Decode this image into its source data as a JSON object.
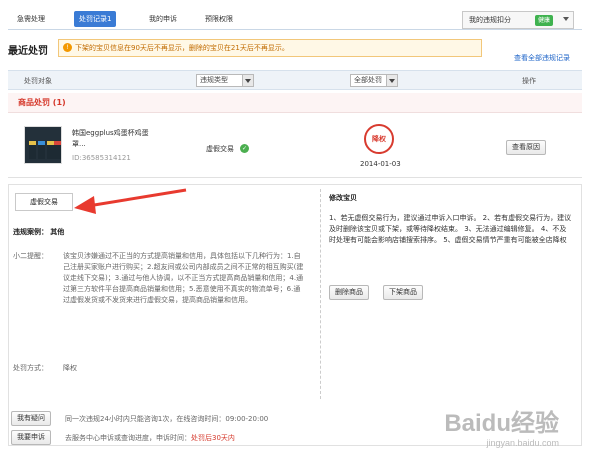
{
  "tabs": [
    "急需处理",
    "处罚记录1",
    "我的申诉",
    "预限权限"
  ],
  "active_tab": 1,
  "score": {
    "label": "我的违规扣分",
    "status": "健康"
  },
  "section_title": "最近处罚",
  "notice": "下架的宝贝信息在90天后不再显示，删除的宝贝在21天后不再显示。",
  "view_all_link": "查看全部违规记录",
  "table_headers": {
    "object": "处罚对象",
    "violation_type": "违规类型",
    "status": "全部处罚",
    "action": "操作"
  },
  "category": "商品处罚 (1)",
  "record": {
    "product_name": "韩国eggplus鸡蛋杯鸡蛋罩...",
    "product_id": "ID:36585314121",
    "violation": "虚假交易",
    "penalty_stamp": "降权",
    "date": "2014-01-03",
    "view_reason_button": "查看原因"
  },
  "detail": {
    "tab_label": "虚假交易",
    "case_label": "违规案例：",
    "case_value": "其他",
    "tip_label": "小二提醒：",
    "tip_text": "该宝贝涉嫌通过不正当的方式提高销量和信用，具体包括以下几种行为：1.自己注册买家账户进行购买；2.超友间或公司内部成员之间不正常的相互购买(建议走线下交易)；3.通过与他人协调，以不正当方式提高商品销量和信用；4.通过第三方软件平台提高商品销量和信用；5.恶意使用不真实的物流单号；6.通过虚假发货或不发货来进行虚假交易，提高商品销量和信用。",
    "penalty_label": "处罚方式：",
    "penalty_value": "降权",
    "ask_button": "我有疑问",
    "ask_text": "同一次违规24小时内只能咨询1次，在线咨询时间：09:00-20:00",
    "appeal_button": "我要申诉",
    "appeal_text": "去服务中心申诉或查询进度，申诉时间：",
    "appeal_deadline": "处罚后30天内",
    "fix_title": "修改宝贝",
    "fix_text": "1、若无虚假交易行为，建议通过申诉入口申诉。 2、若有虚假交易行为，建议及时删除该宝贝或下架，或等待降权结束。 3、无法通过编辑修复。 4、不及时处理有可能会影响店铺搜索排序。 5、虚假交易情节严重有可能被全店降权",
    "delete_button": "删除商品",
    "offline_button": "下架商品"
  },
  "watermark": {
    "brand": "Baidu经验",
    "url": "jingyan.baidu.com"
  },
  "colors": {
    "accent": "#3a7bd5",
    "penalty_red": "#d5372a",
    "healthy_green": "#3fb24f",
    "arrow": "#e83a2f"
  }
}
